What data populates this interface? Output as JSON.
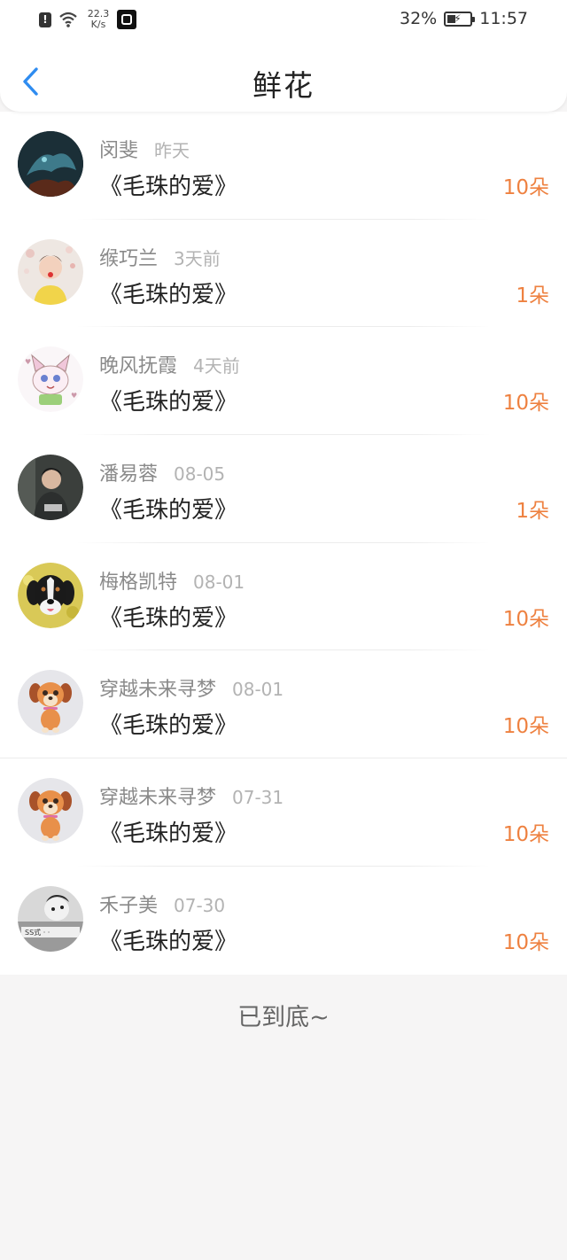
{
  "status_bar": {
    "net_speed_value": "22.3",
    "net_speed_unit": "K/s",
    "battery": "32%",
    "time": "11:57",
    "icons": [
      "alert-icon",
      "wifi-icon",
      "app-notification-icon",
      "battery-charging-icon"
    ]
  },
  "header": {
    "title": "鲜花",
    "back_icon": "chevron-left-icon",
    "accent_color": "#2f8cf0"
  },
  "records": [
    {
      "name": "闵斐",
      "time": "昨天",
      "gift": "《毛珠的爱》",
      "count": "10朵"
    },
    {
      "name": "缑巧兰",
      "time": "3天前",
      "gift": "《毛珠的爱》",
      "count": "1朵"
    },
    {
      "name": "晚风抚霞",
      "time": "4天前",
      "gift": "《毛珠的爱》",
      "count": "10朵"
    },
    {
      "name": "潘易蓉",
      "time": "08-05",
      "gift": "《毛珠的爱》",
      "count": "1朵"
    },
    {
      "name": "梅格凯特",
      "time": "08-01",
      "gift": "《毛珠的爱》",
      "count": "10朵"
    },
    {
      "name": "穿越未来寻梦",
      "time": "08-01",
      "gift": "《毛珠的爱》",
      "count": "10朵"
    },
    {
      "name": "穿越未来寻梦",
      "time": "07-31",
      "gift": "《毛珠的爱》",
      "count": "10朵"
    },
    {
      "name": "禾子美",
      "time": "07-30",
      "gift": "《毛珠的爱》",
      "count": "10朵"
    }
  ],
  "footer": {
    "end_text": "已到底~"
  },
  "colors": {
    "count": "#ee8140",
    "name": "#8a8a8a",
    "time": "#b3b3b3",
    "background": "#f6f5f5"
  }
}
